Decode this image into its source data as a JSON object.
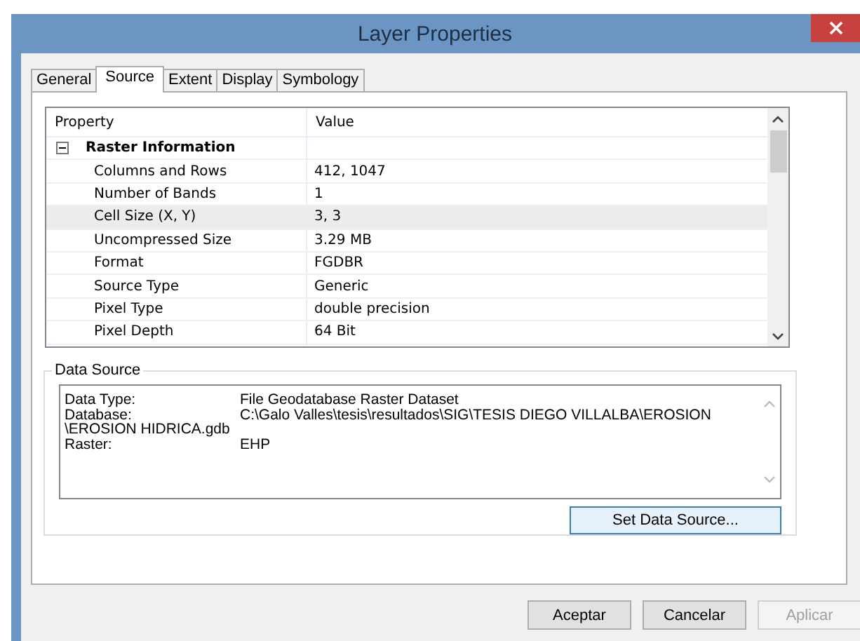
{
  "window": {
    "title": "Layer Properties"
  },
  "tabs": [
    {
      "label": "General",
      "selected": false
    },
    {
      "label": "Source",
      "selected": true
    },
    {
      "label": "Extent",
      "selected": false
    },
    {
      "label": "Display",
      "selected": false
    },
    {
      "label": "Symbology",
      "selected": false
    }
  ],
  "property_grid": {
    "columns": [
      "Property",
      "Value"
    ],
    "group": {
      "label": "Raster Information",
      "expanded": true
    },
    "rows": [
      {
        "property": "Columns and Rows",
        "value": "412, 1047",
        "selected": false
      },
      {
        "property": "Number of Bands",
        "value": "1",
        "selected": false
      },
      {
        "property": "Cell Size (X, Y)",
        "value": "3, 3",
        "selected": true
      },
      {
        "property": "Uncompressed Size",
        "value": "3.29 MB",
        "selected": false
      },
      {
        "property": "Format",
        "value": "FGDBR",
        "selected": false
      },
      {
        "property": "Source Type",
        "value": "Generic",
        "selected": false
      },
      {
        "property": "Pixel Type",
        "value": "double precision",
        "selected": false
      },
      {
        "property": "Pixel Depth",
        "value": "64 Bit",
        "selected": false
      }
    ]
  },
  "data_source": {
    "title": "Data Source",
    "lines": [
      {
        "label": "Data Type:",
        "value": "File Geodatabase Raster Dataset"
      },
      {
        "label": "Database:",
        "value": "C:\\Galo Valles\\tesis\\resultados\\SIG\\TESIS DIEGO VILLALBA\\EROSION",
        "continuation": "\\EROSION HIDRICA.gdb"
      },
      {
        "label": "Raster:",
        "value": "EHP"
      }
    ],
    "button": "Set Data Source..."
  },
  "buttons": [
    {
      "label": "Aceptar",
      "disabled": false
    },
    {
      "label": "Cancelar",
      "disabled": false
    },
    {
      "label": "Aplicar",
      "disabled": true
    }
  ]
}
